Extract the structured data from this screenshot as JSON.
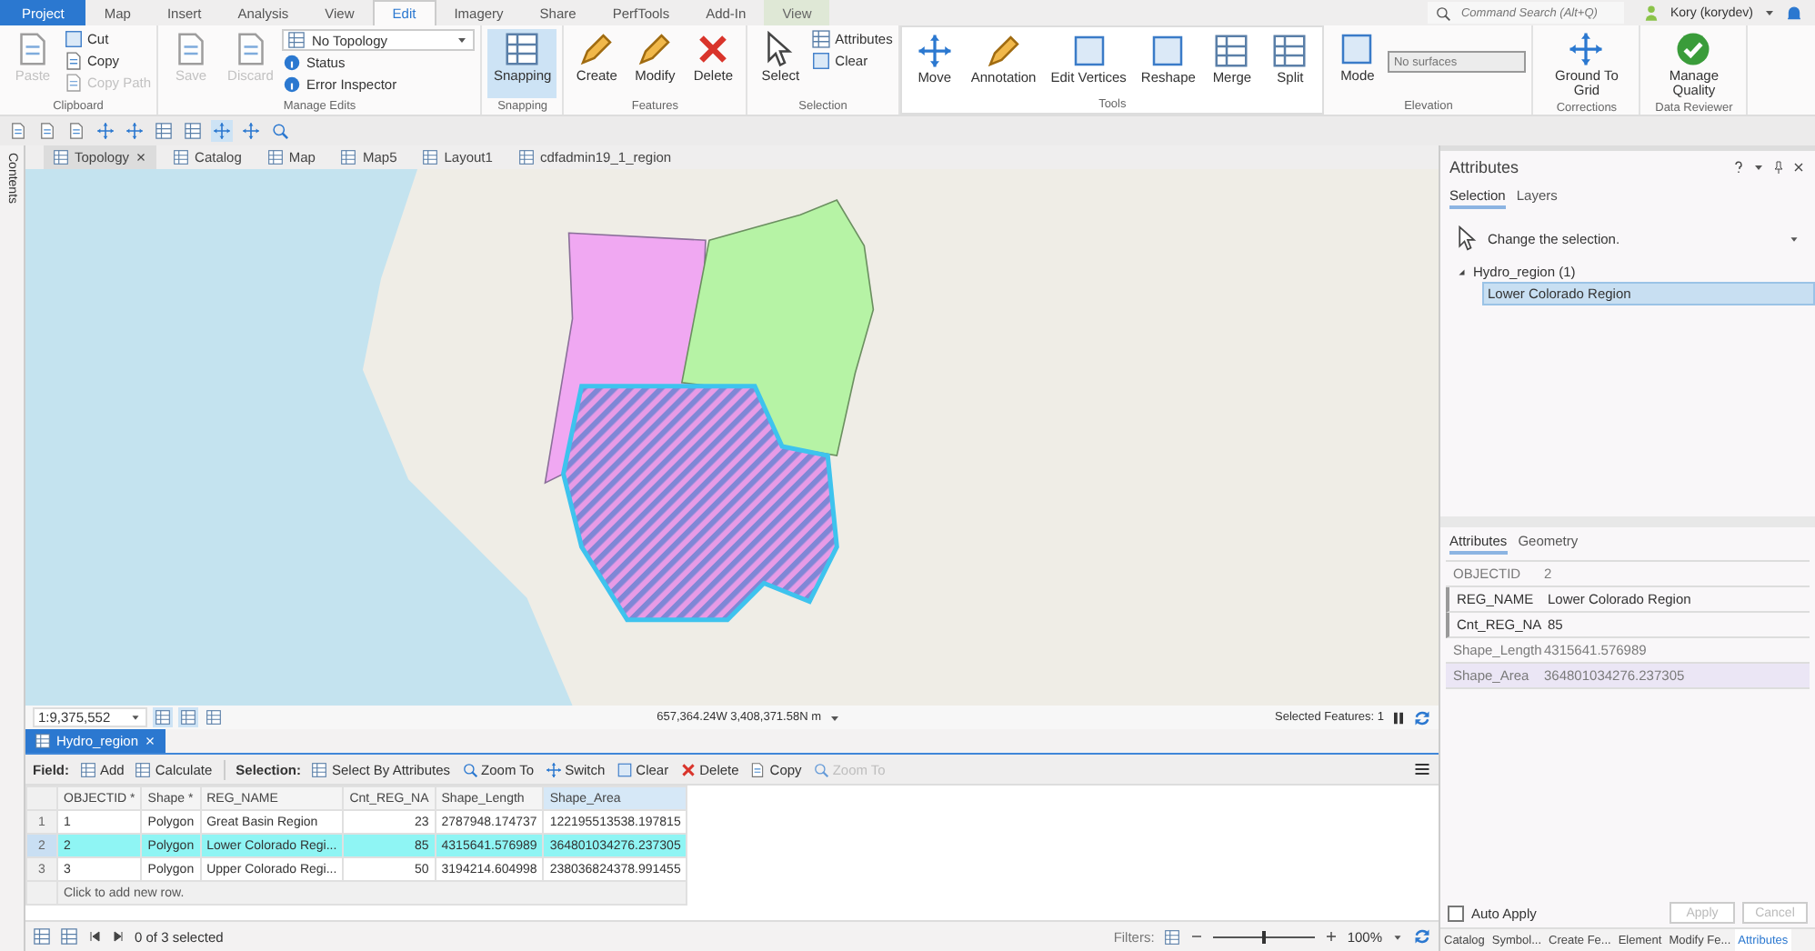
{
  "ribbon": {
    "tabs": [
      {
        "label": "Project",
        "kind": "file",
        "selected": false
      },
      {
        "label": "Map",
        "kind": "normal",
        "selected": false
      },
      {
        "label": "Insert",
        "kind": "normal",
        "selected": false
      },
      {
        "label": "Analysis",
        "kind": "normal",
        "selected": false
      },
      {
        "label": "View",
        "kind": "normal",
        "selected": false
      },
      {
        "label": "Edit",
        "kind": "normal",
        "selected": true
      },
      {
        "label": "Imagery",
        "kind": "normal",
        "selected": false
      },
      {
        "label": "Share",
        "kind": "normal",
        "selected": false
      },
      {
        "label": "PerfTools",
        "kind": "normal",
        "selected": false
      },
      {
        "label": "Add-In",
        "kind": "normal",
        "selected": false
      },
      {
        "label": "View",
        "kind": "contextual",
        "selected": false
      }
    ],
    "command_search": {
      "placeholder": "Command Search (Alt+Q)"
    },
    "user": "Kory (korydev)",
    "groups": [
      {
        "label": "Clipboard",
        "items": [
          {
            "label": "Paste",
            "kind": "large",
            "disabled": true,
            "selected": false
          },
          {
            "label": "Cut",
            "kind": "small",
            "disabled": false
          },
          {
            "label": "Copy",
            "kind": "small",
            "disabled": false
          },
          {
            "label": "Copy Path",
            "kind": "small",
            "disabled": true
          }
        ]
      },
      {
        "label": "Manage Edits",
        "items": [
          {
            "label": "Save",
            "kind": "large",
            "disabled": true,
            "selected": false
          },
          {
            "label": "Discard",
            "kind": "large",
            "disabled": true,
            "selected": false
          },
          {
            "label": "No Topology",
            "kind": "dropdown",
            "disabled": false
          },
          {
            "label": "Status",
            "kind": "small",
            "disabled": false
          },
          {
            "label": "Error Inspector",
            "kind": "small",
            "disabled": false
          }
        ]
      },
      {
        "label": "Snapping",
        "items": [
          {
            "label": "Snapping",
            "kind": "large",
            "disabled": false,
            "selected": true
          }
        ]
      },
      {
        "label": "Features",
        "items": [
          {
            "label": "Create",
            "kind": "large",
            "disabled": false,
            "selected": false
          },
          {
            "label": "Modify",
            "kind": "large",
            "disabled": false,
            "selected": false
          },
          {
            "label": "Delete",
            "kind": "large",
            "disabled": false,
            "selected": false
          }
        ]
      },
      {
        "label": "Selection",
        "items": [
          {
            "label": "Select",
            "kind": "large",
            "disabled": false,
            "selected": false
          },
          {
            "label": "Attributes",
            "kind": "small",
            "disabled": false
          },
          {
            "label": "Clear",
            "kind": "small",
            "disabled": false
          }
        ]
      },
      {
        "label": "Tools",
        "items": [
          {
            "label": "Move",
            "kind": "large",
            "disabled": false,
            "selected": false
          },
          {
            "label": "Annotation",
            "kind": "large",
            "disabled": false,
            "selected": false
          },
          {
            "label": "Edit Vertices",
            "kind": "large",
            "disabled": false,
            "selected": false
          },
          {
            "label": "Reshape",
            "kind": "large",
            "disabled": false,
            "selected": false
          },
          {
            "label": "Merge",
            "kind": "large",
            "disabled": false,
            "selected": false
          },
          {
            "label": "Split",
            "kind": "large",
            "disabled": false,
            "selected": false
          }
        ]
      },
      {
        "label": "Elevation",
        "items": [
          {
            "label": "Mode",
            "kind": "large",
            "disabled": false,
            "selected": false
          },
          {
            "placeholder": "No surfaces",
            "kind": "field",
            "disabled": true
          }
        ]
      },
      {
        "label": "Corrections",
        "items": [
          {
            "label": "Ground To Grid",
            "kind": "large",
            "disabled": false,
            "selected": false
          }
        ]
      },
      {
        "label": "Data Reviewer",
        "items": [
          {
            "label": "Manage Quality",
            "kind": "large",
            "disabled": false,
            "selected": false
          }
        ]
      }
    ]
  },
  "contents_strip": "Contents",
  "view_tabs": [
    {
      "label": "Topology",
      "selected": true,
      "closable": true
    },
    {
      "label": "Catalog",
      "selected": false,
      "closable": false
    },
    {
      "label": "Map",
      "selected": false,
      "closable": false
    },
    {
      "label": "Map5",
      "selected": false,
      "closable": false
    },
    {
      "label": "Layout1",
      "selected": false,
      "closable": false
    },
    {
      "label": "cdfadmin19_1_region",
      "selected": false,
      "closable": false
    }
  ],
  "map_status": {
    "scale": "1:9,375,552",
    "coordinates": "657,364.24W 3,408,371.58N m",
    "selected_features": "Selected Features: 1"
  },
  "table": {
    "tab": "Hydro_region",
    "field_label": "Field:",
    "field_tools": [
      {
        "label": "Add",
        "disabled": false
      },
      {
        "label": "Calculate",
        "disabled": false
      }
    ],
    "selection_label": "Selection:",
    "selection_tools": [
      {
        "label": "Select By Attributes",
        "disabled": false
      },
      {
        "label": "Zoom To",
        "disabled": false
      },
      {
        "label": "Switch",
        "disabled": false
      },
      {
        "label": "Clear",
        "disabled": false
      },
      {
        "label": "Delete",
        "disabled": false
      },
      {
        "label": "Copy",
        "disabled": false
      },
      {
        "label": "Zoom To",
        "disabled": true
      }
    ],
    "columns": [
      {
        "label": "OBJECTID *",
        "selected": false,
        "kind": "text"
      },
      {
        "label": "Shape *",
        "selected": false,
        "kind": "text"
      },
      {
        "label": "REG_NAME",
        "selected": false,
        "kind": "text"
      },
      {
        "label": "Cnt_REG_NA",
        "selected": false,
        "kind": "integer"
      },
      {
        "label": "Shape_Length",
        "selected": false,
        "kind": "text"
      },
      {
        "label": "Shape_Area",
        "selected": true,
        "kind": "text"
      }
    ],
    "rows": [
      {
        "number": "1",
        "selected": false,
        "cells": [
          "1",
          "Polygon",
          "Great Basin Region",
          "23",
          "2787948.174737",
          "122195513538.197815"
        ]
      },
      {
        "number": "2",
        "selected": true,
        "cells": [
          "2",
          "Polygon",
          "Lower Colorado Regi...",
          "85",
          "4315641.576989",
          "364801034276.237305"
        ]
      },
      {
        "number": "3",
        "selected": false,
        "cells": [
          "3",
          "Polygon",
          "Upper Colorado Regi...",
          "50",
          "3194214.604998",
          "238036824378.991455"
        ]
      }
    ],
    "add_row": "Click to add new row.",
    "footer": {
      "selection_count": "0 of 3 selected",
      "filters_label": "Filters:",
      "zoom": {
        "level": 0.5
      },
      "zoom_reading": "100%"
    }
  },
  "attributes_pane": {
    "title": "Attributes",
    "tabs": [
      {
        "label": "Selection",
        "selected": true
      },
      {
        "label": "Layers",
        "selected": false
      }
    ],
    "change_selection": "Change the selection.",
    "tree": [
      {
        "label": "Hydro_region (1)",
        "expanded": true,
        "selected": false,
        "children": [
          {
            "label": "Lower Colorado Region",
            "selected": true
          }
        ]
      }
    ],
    "detail_tabs": [
      {
        "label": "Attributes",
        "selected": true
      },
      {
        "label": "Geometry",
        "selected": false
      }
    ],
    "fields": [
      {
        "name": "OBJECTID",
        "value": "2",
        "editable": false,
        "selected": false
      },
      {
        "name": "REG_NAME",
        "value": "Lower Colorado Region",
        "editable": true,
        "selected": false
      },
      {
        "name": "Cnt_REG_NA",
        "value": "85",
        "editable": true,
        "selected": false
      },
      {
        "name": "Shape_Length",
        "value": "4315641.576989",
        "editable": false,
        "selected": false
      },
      {
        "name": "Shape_Area",
        "value": "364801034276.237305",
        "editable": false,
        "selected": true
      }
    ],
    "auto_apply": {
      "label": "Auto Apply",
      "checked": false
    },
    "buttons": [
      {
        "label": "Apply",
        "disabled": true
      },
      {
        "label": "Cancel",
        "disabled": true
      }
    ],
    "pane_tabs": [
      {
        "label": "Catalog",
        "selected": false
      },
      {
        "label": "Symbol...",
        "selected": false
      },
      {
        "label": "Create Fe...",
        "selected": false
      },
      {
        "label": "Element",
        "selected": false
      },
      {
        "label": "Modify Fe...",
        "selected": false
      },
      {
        "label": "Attributes",
        "selected": true
      }
    ]
  }
}
